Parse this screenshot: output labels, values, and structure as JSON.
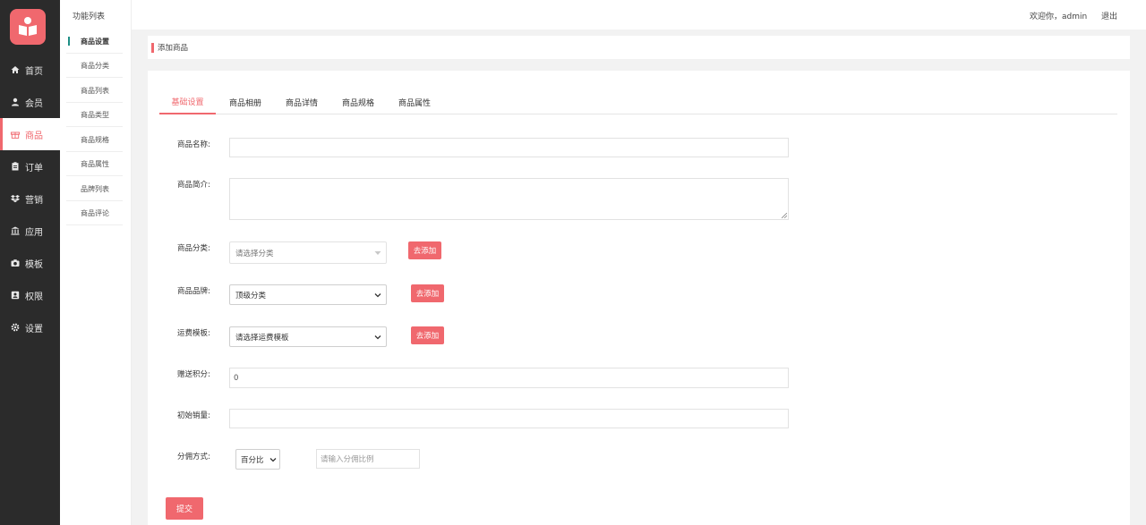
{
  "sidebar": {
    "items": [
      {
        "label": "首页",
        "icon": "home-icon"
      },
      {
        "label": "会员",
        "icon": "user-icon"
      },
      {
        "label": "商品",
        "icon": "gift-icon"
      },
      {
        "label": "订单",
        "icon": "clipboard-icon"
      },
      {
        "label": "营销",
        "icon": "dropbox-icon"
      },
      {
        "label": "应用",
        "icon": "bank-icon"
      },
      {
        "label": "模板",
        "icon": "camera-icon"
      },
      {
        "label": "权限",
        "icon": "id-card-icon"
      },
      {
        "label": "设置",
        "icon": "gear-icon"
      }
    ],
    "active_index": 2
  },
  "submenu": {
    "header": "功能列表",
    "items": [
      "商品设置",
      "商品分类",
      "商品列表",
      "商品类型",
      "商品规格",
      "商品属性",
      "品牌列表",
      "商品评论"
    ]
  },
  "header": {
    "welcome": "欢迎你，admin",
    "logout": "退出"
  },
  "breadcrumb": "添加商品",
  "tabs": [
    "基础设置",
    "商品相册",
    "商品详情",
    "商品规格",
    "商品属性"
  ],
  "form": {
    "name_label": "商品名称:",
    "name_value": "",
    "intro_label": "商品简介:",
    "category_label": "商品分类:",
    "category_placeholder": "请选择分类",
    "brand_label": "商品品牌:",
    "brand_value": "顶级分类",
    "shipping_label": "运费模板:",
    "shipping_value": "请选择运费模板",
    "points_label": "赠送积分:",
    "points_value": "0",
    "sales_label": "初始销量:",
    "sales_value": "",
    "commission_label": "分佣方式:",
    "commission_type": "百分比",
    "commission_placeholder": "请输入分佣比例",
    "go_add": "去添加",
    "submit": "提交"
  },
  "colors": {
    "accent": "#f0686e",
    "sidebar_bg": "#2b2b2b",
    "submenu_marker": "#1f8f86"
  }
}
